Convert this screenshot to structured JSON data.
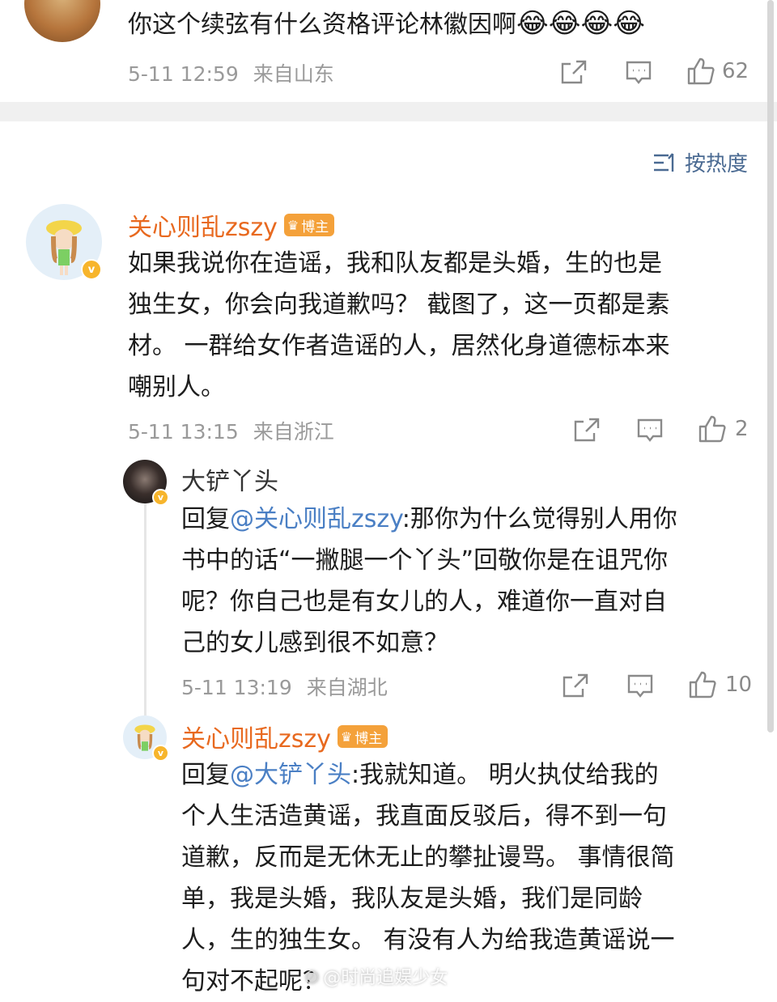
{
  "prev_comment": {
    "text": "你这个续弦有什么资格评论林徽因啊",
    "emoji": [
      "😂",
      "😂",
      "😂",
      "😂"
    ],
    "time": "5-11 12:59",
    "location": "来自山东",
    "likes": "62"
  },
  "sort": {
    "label": "按热度",
    "icon": "sort-icon"
  },
  "comment": {
    "author": "关心则乱zszy",
    "badge": "博主",
    "lines": [
      "如果我说你在造谣，我和队友都是头婚，生的也是",
      "独生女，你会向我道歉吗？  截图了，这一页都是素",
      "材。  一群给女作者造谣的人，居然化身道德标本来",
      "嘲别人。"
    ],
    "time": "5-11 13:15",
    "location": "来自浙江",
    "likes": "2"
  },
  "reply1": {
    "author": "大铲丫头",
    "reply_prefix": "回复",
    "mention": "@关心则乱zszy",
    "lines": [
      ":那你为什么觉得别人用你",
      "书中的话“一撇腿一个丫头”回敬你是在诅咒你",
      "呢？你自己也是有女儿的人，难道你一直对自",
      "己的女儿感到很不如意？"
    ],
    "time": "5-11 13:19",
    "location": "来自湖北",
    "likes": "10"
  },
  "reply2": {
    "author": "关心则乱zszy",
    "badge": "博主",
    "reply_prefix": "回复",
    "mention": "@大铲丫头",
    "lines": [
      ":我就知道。  明火执仗给我的",
      "个人生活造黄谣，我直面反驳后，得不到一句",
      "道歉，反而是无休无止的攀扯谩骂。  事情很简",
      "单，我是头婚，我队友是头婚，我们是同龄",
      "人，生的独生女。 有没有人为给我造黄谣说一",
      "句对不起呢？"
    ]
  },
  "watermark": "@时尚追娱少女",
  "colors": {
    "accent": "#e8691f",
    "mention": "#4a7fc4",
    "meta": "#9a9a9a",
    "divider": "#f0f0f0"
  }
}
